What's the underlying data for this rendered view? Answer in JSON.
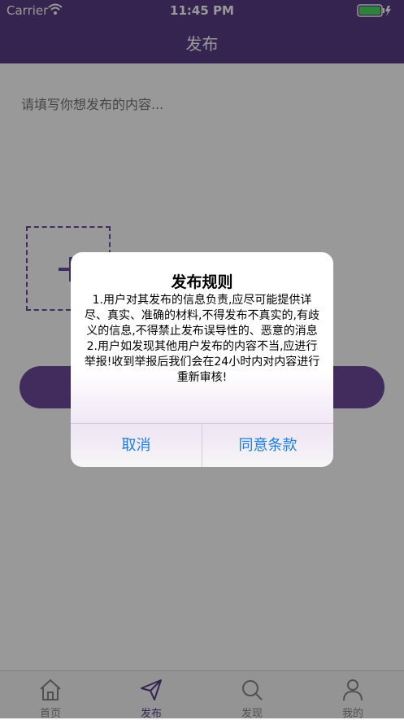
{
  "status_bar": {
    "carrier": "Carrier",
    "time": "11:45 PM"
  },
  "nav": {
    "title": "发布"
  },
  "post": {
    "placeholder": "请填写你想发布的内容..."
  },
  "tabs": [
    {
      "label": "首页",
      "icon": "home-icon"
    },
    {
      "label": "发布",
      "icon": "send-icon",
      "active": true
    },
    {
      "label": "发现",
      "icon": "search-icon"
    },
    {
      "label": "我的",
      "icon": "person-icon"
    }
  ],
  "dialog": {
    "title": "发布规则",
    "message": "1.用户对其发布的信息负责,应尽可能提供详尽、真实、准确的材料,不得发布不真实的,有歧义的信息,不得禁止发布误导性的、恶意的消息\n2.用户如发现其他用户发布的内容不当,应进行举报!收到举报后我们会在24小时内对内容进行重新审核!",
    "cancel_label": "取消",
    "agree_label": "同意条款"
  },
  "colors": {
    "accent": "#5b3d86",
    "button": "#6d4a9c",
    "link": "#1a7ee0"
  }
}
